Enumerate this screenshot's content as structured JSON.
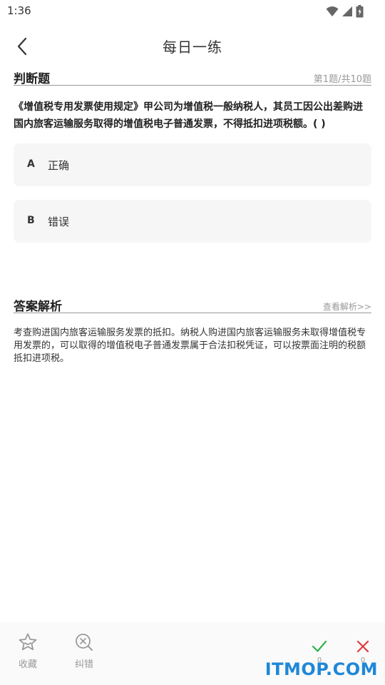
{
  "status_bar": {
    "time": "1:36"
  },
  "nav": {
    "title": "每日一练"
  },
  "question_section": {
    "title": "判断题",
    "progress": "第1题/共10题"
  },
  "question": {
    "text": "《增值税专用发票使用规定》甲公司为增值税一般纳税人，其员工因公出差购进国内旅客运输服务取得的增值税电子普通发票，不得抵扣进项税额。( )"
  },
  "options": [
    {
      "key": "A",
      "text": "正确"
    },
    {
      "key": "B",
      "text": "错误"
    }
  ],
  "analysis_section": {
    "title": "答案解析",
    "link": "查看解析>>"
  },
  "analysis": {
    "text": "考查购进国内旅客运输服务发票的抵扣。纳税人购进国内旅客运输服务未取得增值税专用发票的，可以取得的增值税电子普通发票属于合法扣税凭证，可以按票面注明的税额抵扣进项税。"
  },
  "bottom_bar": {
    "favorite_label": "收藏",
    "favorite_icon": "star-icon",
    "correction_label": "纠错",
    "correction_icon": "search-x-icon",
    "correct_count": "0",
    "wrong_count": "0",
    "correct_color": "#2db24a",
    "wrong_color": "#e03a3a"
  },
  "watermark": {
    "text": "ITMOP.COM"
  }
}
